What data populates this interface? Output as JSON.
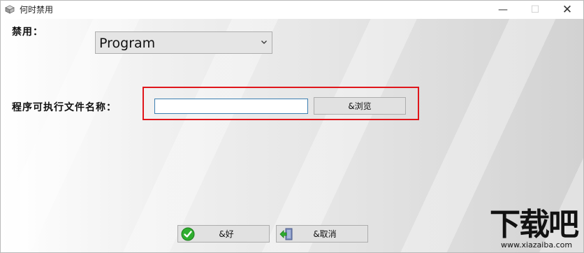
{
  "window": {
    "title": "何时禁用",
    "min_symbol": "—",
    "max_symbol": "☐",
    "close_symbol": "✕"
  },
  "form": {
    "disable_label": "禁用：",
    "disable_value": "Program",
    "file_label": "程序可执行文件名称：",
    "file_value": "",
    "browse_label": "&浏览",
    "ok_label": "&好",
    "cancel_label": "&取消"
  },
  "icons": {
    "app": "app-icon",
    "combo_arrow": "chevron-down-icon",
    "ok": "green-check-icon",
    "cancel": "exit-door-icon"
  },
  "colors": {
    "highlight": "#e0161b",
    "input_border": "#3c7fb1"
  },
  "watermark": {
    "brand": "下载吧",
    "url": "www.xiazaiba.com"
  }
}
